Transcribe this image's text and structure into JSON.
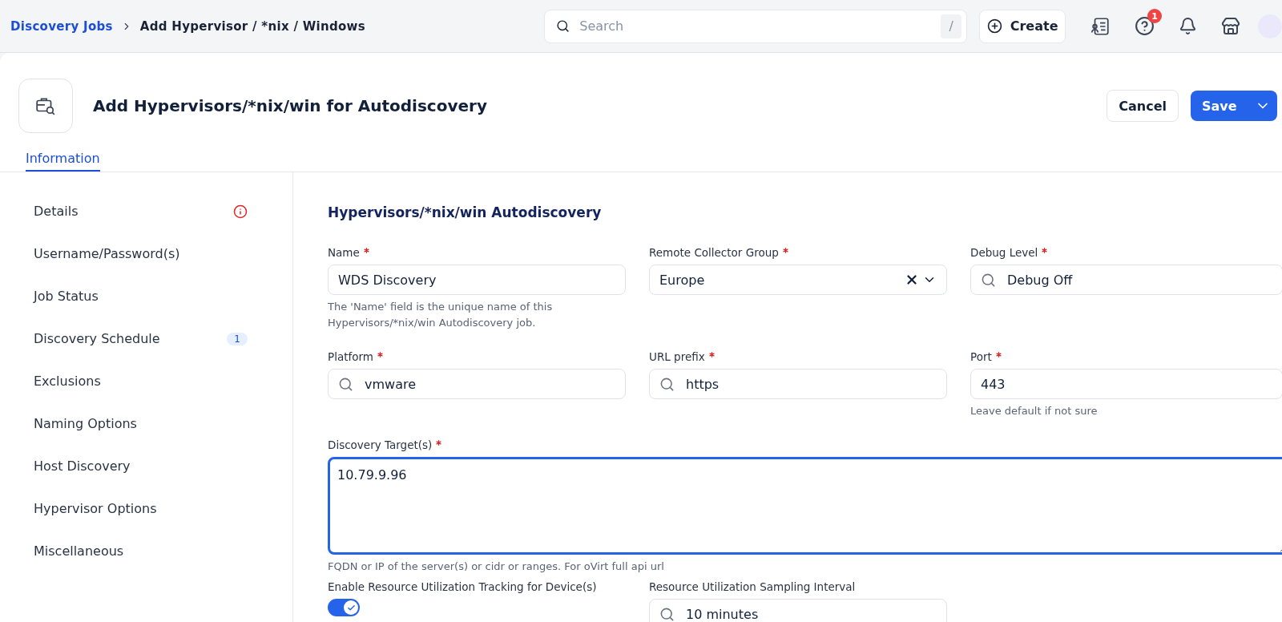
{
  "breadcrumb": [
    {
      "label": "Discovery Jobs",
      "kind": "link"
    },
    {
      "label": "Add Hypervisor / *nix / Windows",
      "kind": "current"
    }
  ],
  "search": {
    "placeholder": "Search",
    "shortcut": "/"
  },
  "create_button": "Create",
  "help_badge": "1",
  "header": {
    "title": "Add Hypervisors/*nix/win for Autodiscovery",
    "cancel": "Cancel",
    "save": "Save"
  },
  "tabs": [
    {
      "label": "Information",
      "selected": true
    }
  ],
  "sidebar": [
    {
      "label": "Details",
      "kind": "error"
    },
    {
      "label": "Username/Password(s)",
      "kind": "plain"
    },
    {
      "label": "Job Status",
      "kind": "plain"
    },
    {
      "label": "Discovery Schedule",
      "kind": "count",
      "count": "1"
    },
    {
      "label": "Exclusions",
      "kind": "plain"
    },
    {
      "label": "Naming Options",
      "kind": "plain"
    },
    {
      "label": "Host Discovery",
      "kind": "plain"
    },
    {
      "label": "Hypervisor Options",
      "kind": "plain"
    },
    {
      "label": "Miscellaneous",
      "kind": "plain"
    }
  ],
  "form": {
    "heading": "Hypervisors/*nix/win Autodiscovery",
    "fields": [
      {
        "label": "Name",
        "required": true,
        "kind": "text",
        "value": "WDS Discovery",
        "help": "The 'Name' field is the unique name of this Hypervisors/*nix/win Autodiscovery job."
      },
      {
        "label": "Remote Collector Group",
        "required": true,
        "kind": "select",
        "value": "Europe"
      },
      {
        "label": "Debug Level",
        "required": true,
        "kind": "search",
        "value": "Debug Off"
      },
      {
        "label": "Platform",
        "required": true,
        "kind": "search",
        "value": "vmware"
      },
      {
        "label": "URL prefix",
        "required": true,
        "kind": "search",
        "value": "https"
      },
      {
        "label": "Port",
        "required": true,
        "kind": "text",
        "value": "443",
        "help": "Leave default if not sure"
      },
      {
        "label": "Discovery Target(s)",
        "required": true,
        "kind": "textarea",
        "value": "10.79.9.96",
        "help": "FQDN or IP of the server(s) or cidr or ranges. For oVirt full api url"
      },
      {
        "label": "Enable Resource Utilization Tracking for Device(s)",
        "kind": "toggle",
        "on": true
      },
      {
        "label": "Resource Utilization Sampling Interval",
        "kind": "search",
        "value": "10 minutes"
      }
    ]
  }
}
